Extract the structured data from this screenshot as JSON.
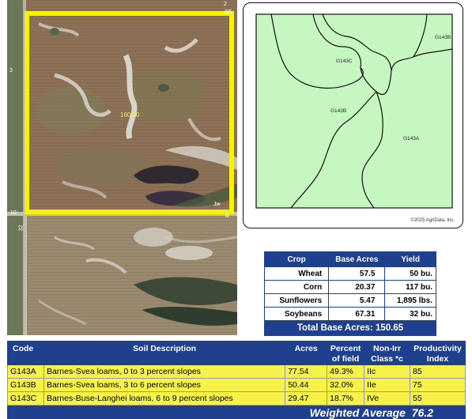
{
  "aerial": {
    "acres_label": "160.00",
    "corner_labels": [
      "2",
      "SE",
      "10",
      "3",
      "Jw",
      "ill",
      "32"
    ]
  },
  "soil_map": {
    "labels": [
      "G143B",
      "G143C",
      "G143B",
      "G143A"
    ],
    "copyright": "©2025 AgriData, Inc.",
    "fill_color": "#c7f7c1",
    "line_color": "#111111"
  },
  "crop_table": {
    "headers": [
      "Crop",
      "Base Acres",
      "Yield"
    ],
    "rows": [
      {
        "crop": "Wheat",
        "acres": "57.5",
        "yield": "50 bu."
      },
      {
        "crop": "Corn",
        "acres": "20.37",
        "yield": "117 bu."
      },
      {
        "crop": "Sunflowers",
        "acres": "5.47",
        "yield": "1,895 lbs."
      },
      {
        "crop": "Soybeans",
        "acres": "67.31",
        "yield": "32 bu."
      }
    ],
    "total_label": "Total Base Acres:",
    "total_value": "150.65"
  },
  "soil_table": {
    "headers": {
      "code": "Code",
      "description": "Soil Description",
      "acres": "Acres",
      "percent_1": "Percent",
      "percent_2": "of field",
      "class_1": "Non-Irr",
      "class_2": "Class *c",
      "index_1": "Productivity",
      "index_2": "Index"
    },
    "rows": [
      {
        "code": "G143A",
        "description": "Barnes-Svea loams, 0 to 3 percent slopes",
        "acres": "77.54",
        "percent": "49.3%",
        "class": "IIc",
        "index": "85"
      },
      {
        "code": "G143B",
        "description": "Barnes-Svea loams, 3 to 6 percent slopes",
        "acres": "50.44",
        "percent": "32.0%",
        "class": "IIe",
        "index": "75"
      },
      {
        "code": "G143C",
        "description": "Barnes-Buse-Langhei loams, 6 to 9 percent slopes",
        "acres": "29.47",
        "percent": "18.7%",
        "class": "IVe",
        "index": "55"
      }
    ],
    "weighted_label": "Weighted Average",
    "weighted_value": "76.2"
  },
  "colors": {
    "header_blue": "#1f3f8f",
    "row_yellow": "#f7f24a",
    "field_outline": "#f7f200"
  }
}
